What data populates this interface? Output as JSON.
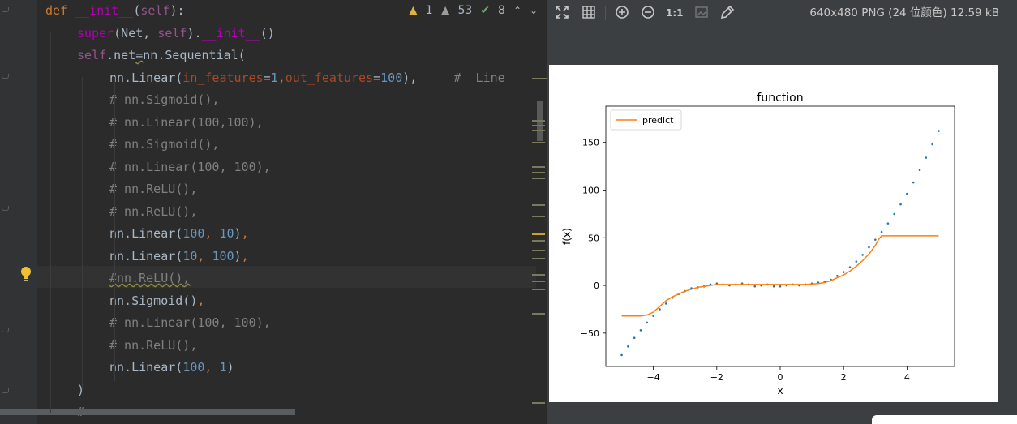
{
  "editor": {
    "inspection": {
      "warnings": "1",
      "weak_warnings": "53",
      "typos": "8"
    },
    "code_lines": [
      [
        [
          "kw",
          "def "
        ],
        [
          "dunder",
          "__init__"
        ],
        [
          "plain",
          "("
        ],
        [
          "self",
          "self"
        ],
        [
          "plain",
          "):"
        ]
      ],
      [
        [
          "fn",
          "super"
        ],
        [
          "plain",
          "(Net, "
        ],
        [
          "self",
          "self"
        ],
        [
          "plain",
          ")."
        ],
        [
          "dunder",
          "__init__"
        ],
        [
          "plain",
          "()"
        ]
      ],
      [
        [
          "self",
          "self"
        ],
        [
          "plain",
          ".net"
        ],
        [
          "sq",
          "="
        ],
        [
          "plain",
          "nn.Sequential("
        ]
      ],
      [
        [
          "plain",
          "nn.Linear("
        ],
        [
          "param",
          "in_features"
        ],
        [
          "plain",
          "="
        ],
        [
          "num",
          "1"
        ],
        [
          "kw",
          ","
        ],
        [
          "param",
          "out_features"
        ],
        [
          "plain",
          "="
        ],
        [
          "num",
          "100"
        ],
        [
          "plain",
          "),"
        ],
        [
          "plain",
          "     "
        ],
        [
          "cm",
          "#  Line"
        ]
      ],
      [
        [
          "cm",
          "# nn.Sigmoid(),"
        ]
      ],
      [
        [
          "cm",
          "# nn.Linear(100,100),"
        ]
      ],
      [
        [
          "cm",
          "# nn.Sigmoid(),"
        ]
      ],
      [
        [
          "cm",
          "# nn.Linear(100, 100),"
        ]
      ],
      [
        [
          "cm",
          "# nn.ReLU(),"
        ]
      ],
      [
        [
          "cm",
          "# nn.ReLU(),"
        ]
      ],
      [
        [
          "plain",
          "nn.Linear("
        ],
        [
          "num",
          "100"
        ],
        [
          "kw",
          ", "
        ],
        [
          "num",
          "10"
        ],
        [
          "plain",
          ")"
        ],
        [
          "kw",
          ","
        ]
      ],
      [
        [
          "plain",
          "nn.Linear("
        ],
        [
          "num",
          "10"
        ],
        [
          "kw",
          ", "
        ],
        [
          "num",
          "100"
        ],
        [
          "plain",
          ")"
        ],
        [
          "kw",
          ","
        ]
      ],
      [
        [
          "cm",
          "#nn.ReLU(),"
        ]
      ],
      [
        [
          "plain",
          "nn.Sigmoid()"
        ],
        [
          "kw",
          ","
        ]
      ],
      [
        [
          "cm",
          "# nn.Linear(100, 100),"
        ]
      ],
      [
        [
          "cm",
          "# nn.ReLU(),"
        ]
      ],
      [
        [
          "plain",
          "nn.Linear("
        ],
        [
          "num",
          "100"
        ],
        [
          "kw",
          ", "
        ],
        [
          "num",
          "1"
        ],
        [
          "plain",
          ")"
        ]
      ],
      [
        [
          "plain",
          ")"
        ]
      ],
      [
        [
          "cm",
          "#"
        ]
      ]
    ]
  },
  "viewer": {
    "image_info": "640x480 PNG (24 位颜色) 12.59 kB",
    "toolbar_icons": [
      "fit-screen-icon",
      "grid-icon",
      "zoom-in-icon",
      "zoom-out-icon",
      "actual-size-icon",
      "background-icon",
      "color-picker-icon"
    ],
    "actual_size_label": "1:1"
  },
  "chart_data": {
    "type": "line",
    "title": "function",
    "xlabel": "x",
    "ylabel": "f(x)",
    "xlim": [
      -5.5,
      5.5
    ],
    "ylim": [
      -85,
      188
    ],
    "xticks": [
      -4,
      -2,
      0,
      2,
      4
    ],
    "xtick_labels": [
      "−4",
      "−2",
      "0",
      "2",
      "4"
    ],
    "yticks": [
      -50,
      0,
      50,
      100,
      150
    ],
    "ytick_labels": [
      "−50",
      "0",
      "50",
      "100",
      "150"
    ],
    "legend": {
      "placement": "top-left",
      "entries": [
        "predict"
      ]
    },
    "colors": {
      "scatter": "#1f77b4",
      "predict": "#ff7f0e"
    },
    "series": [
      {
        "type": "scatter",
        "x": [
          -5.0,
          -4.8,
          -4.6,
          -4.4,
          -4.2,
          -4.0,
          -3.8,
          -3.6,
          -3.4,
          -3.2,
          -3.0,
          -2.8,
          -2.6,
          -2.4,
          -2.2,
          -2.0,
          -1.8,
          -1.6,
          -1.4,
          -1.2,
          -1.0,
          -0.8,
          -0.6,
          -0.4,
          -0.2,
          0.0,
          0.2,
          0.4,
          0.6,
          0.8,
          1.0,
          1.2,
          1.4,
          1.6,
          1.8,
          2.0,
          2.2,
          2.4,
          2.6,
          2.8,
          3.0,
          3.2,
          3.4,
          3.6,
          3.8,
          4.0,
          4.2,
          4.4,
          4.6,
          4.8,
          5.0
        ],
        "y": [
          -73,
          -64,
          -55,
          -47,
          -39,
          -32,
          -25,
          -19,
          -13,
          -9,
          -6,
          -3,
          -2,
          -1,
          1,
          2,
          1,
          0,
          1,
          2,
          1,
          -1,
          0,
          1,
          -1,
          -1,
          0,
          1,
          0,
          1,
          2,
          3,
          4,
          6,
          10,
          14,
          19,
          25,
          32,
          40,
          48,
          56,
          65,
          75,
          85,
          96,
          108,
          121,
          134,
          148,
          162
        ]
      },
      {
        "name": "predict",
        "type": "line",
        "x": [
          -5.0,
          -4.6,
          -4.4,
          -4.2,
          -4.0,
          -3.8,
          -3.6,
          -3.4,
          -3.2,
          -3.0,
          -2.8,
          -2.6,
          -2.4,
          -2.2,
          -2.0,
          -1.6,
          -1.2,
          -0.8,
          -0.4,
          0.0,
          0.4,
          0.8,
          1.2,
          1.4,
          1.6,
          1.8,
          2.0,
          2.2,
          2.4,
          2.6,
          2.8,
          3.0,
          3.1,
          3.2,
          3.4,
          3.8,
          4.4,
          5.0
        ],
        "y": [
          -32,
          -32,
          -32,
          -31,
          -28,
          -22,
          -16,
          -12,
          -9,
          -6,
          -4,
          -2,
          -1,
          0,
          1,
          1,
          1,
          1,
          1,
          1,
          1,
          1,
          2,
          3,
          5,
          8,
          11,
          15,
          20,
          26,
          33,
          42,
          48,
          52,
          52,
          52,
          52,
          52
        ]
      }
    ]
  }
}
